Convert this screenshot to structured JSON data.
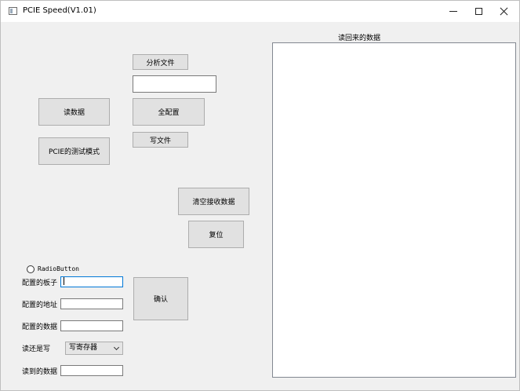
{
  "window": {
    "title": "PCIE Speed(V1.01)"
  },
  "buttons": {
    "analyze_file": "分析文件",
    "read_data": "读数据",
    "configure_all": "全配置",
    "write_file": "写文件",
    "pcie_test_mode": "PCIE的测试模式",
    "clear_receive": "清空接收数据",
    "reset": "复位",
    "confirm": "确认"
  },
  "file_path_input": {
    "value": ""
  },
  "radio": {
    "label": "RadioButton",
    "checked": false
  },
  "form": {
    "board_label": "配置的板子",
    "board_value": "",
    "address_label": "配置的地址",
    "address_value": "",
    "data_label": "配置的数据",
    "data_value": "",
    "rw_label": "读还是写",
    "rw_selected": "写寄存器",
    "read_data_label": "读到的数据",
    "read_data_value": ""
  },
  "readback_panel": {
    "title": "读回来的数据",
    "content": ""
  }
}
